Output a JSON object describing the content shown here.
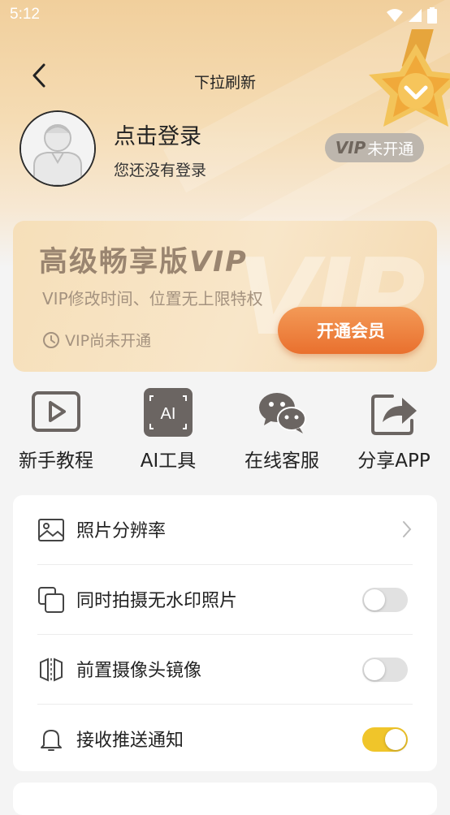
{
  "status_bar": {
    "time": "5:12"
  },
  "nav": {
    "title": "下拉刷新"
  },
  "user": {
    "login_title": "点击登录",
    "login_subtitle": "您还没有登录",
    "vip_badge_mark": "VIP",
    "vip_badge_text": "未开通"
  },
  "vip_card": {
    "title": "高级畅享版",
    "title_vip": "VIP",
    "subtitle": "VIP修改时间、位置无上限特权",
    "status": "VIP尚未开通",
    "open_button": "开通会员",
    "watermark": "VIP"
  },
  "tools": [
    {
      "label": "新手教程",
      "icon": "play-icon"
    },
    {
      "label": "AI工具",
      "icon": "ai-icon"
    },
    {
      "label": "在线客服",
      "icon": "wechat-icon"
    },
    {
      "label": "分享APP",
      "icon": "share-icon"
    }
  ],
  "settings": [
    {
      "label": "照片分辨率",
      "icon": "image-icon",
      "control": "chevron"
    },
    {
      "label": "同时拍摄无水印照片",
      "icon": "copy-icon",
      "control": "toggle",
      "on": false
    },
    {
      "label": "前置摄像头镜像",
      "icon": "mirror-icon",
      "control": "toggle",
      "on": false
    },
    {
      "label": "接收推送通知",
      "icon": "bell-icon",
      "control": "toggle",
      "on": true
    }
  ],
  "colors": {
    "accent": "#e9702e",
    "toggle_on": "#f0c52a",
    "header": "#f1cf9c"
  }
}
